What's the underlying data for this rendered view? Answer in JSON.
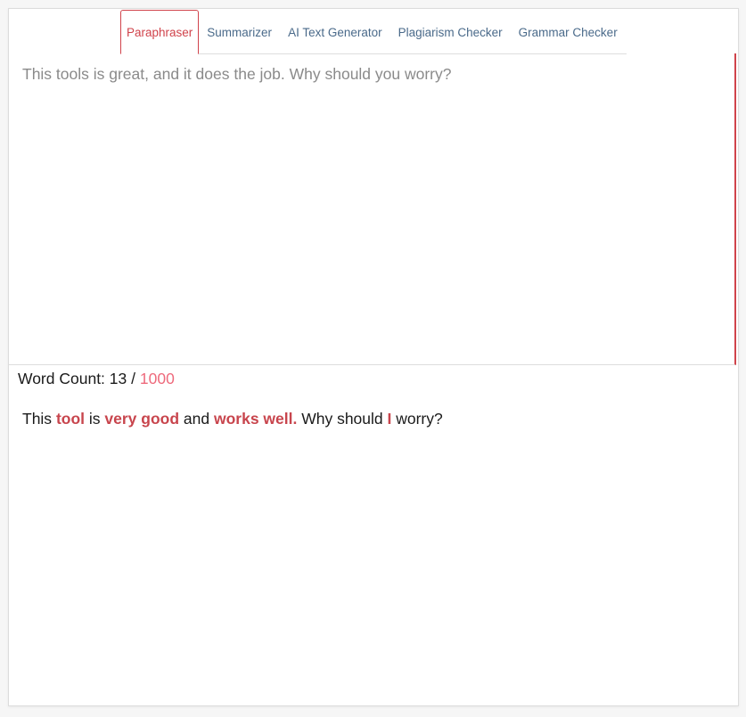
{
  "tabs": [
    {
      "label": "Paraphraser",
      "active": true
    },
    {
      "label": "Summarizer",
      "active": false
    },
    {
      "label": "AI Text Generator",
      "active": false
    },
    {
      "label": "Plagiarism Checker",
      "active": false
    },
    {
      "label": "Grammar Checker",
      "active": false
    }
  ],
  "input": {
    "text": "This tools is great, and it does the job. Why should you worry?"
  },
  "word_count": {
    "label": "Word Count:",
    "count": "13",
    "separator": "/",
    "limit": "1000"
  },
  "output": {
    "segments": [
      {
        "text": "This ",
        "changed": false
      },
      {
        "text": "tool",
        "changed": true
      },
      {
        "text": " is ",
        "changed": false
      },
      {
        "text": "very good",
        "changed": true
      },
      {
        "text": " and ",
        "changed": false
      },
      {
        "text": "works well.",
        "changed": true
      },
      {
        "text": " Why should ",
        "changed": false
      },
      {
        "text": "I",
        "changed": true
      },
      {
        "text": " worry?",
        "changed": false
      }
    ]
  },
  "colors": {
    "accent": "#d0434b",
    "tab_text": "#4a6a8a",
    "limit_text": "#ee6a7c",
    "placeholder_text": "#8a8a8a"
  }
}
